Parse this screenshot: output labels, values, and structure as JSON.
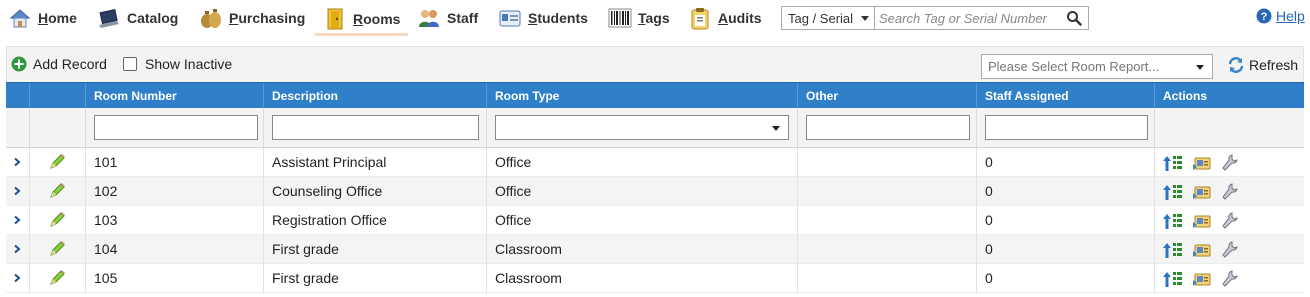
{
  "nav": {
    "items": [
      {
        "id": "home",
        "label_first": "H",
        "label_rest": "ome",
        "icon": "home-icon"
      },
      {
        "id": "catalog",
        "label_first": "",
        "label_rest": "Catalog",
        "icon": "laptop-icon"
      },
      {
        "id": "purchasing",
        "label_first": "P",
        "label_rest": "urchasing",
        "icon": "money-bags-icon"
      },
      {
        "id": "rooms",
        "label_first": "R",
        "label_rest": "ooms",
        "icon": "door-icon",
        "active": true
      },
      {
        "id": "staff",
        "label_first": "",
        "label_rest": "Staff",
        "icon": "people-icon"
      },
      {
        "id": "students",
        "label_first": "S",
        "label_rest": "tudents",
        "icon": "id-card-icon"
      },
      {
        "id": "tags",
        "label_first": "T",
        "label_rest": "ags",
        "icon": "barcode-icon"
      },
      {
        "id": "audits",
        "label_first": "A",
        "label_rest": "udits",
        "icon": "clipboard-icon"
      }
    ],
    "search": {
      "field_select": "Tag / Serial",
      "placeholder": "Search Tag or Serial Number"
    },
    "help_label": "Help"
  },
  "toolbar": {
    "add_record": "Add Record",
    "show_inactive": "Show Inactive",
    "report_placeholder": "Please Select Room Report...",
    "refresh": "Refresh"
  },
  "grid": {
    "columns": [
      "Room Number",
      "Description",
      "Room Type",
      "Other",
      "Staff Assigned",
      "Actions"
    ],
    "rows": [
      {
        "room": "101",
        "description": "Assistant Principal",
        "type": "Office",
        "other": "",
        "staff": "0"
      },
      {
        "room": "102",
        "description": "Counseling Office",
        "type": "Office",
        "other": "",
        "staff": "0"
      },
      {
        "room": "103",
        "description": "Registration Office",
        "type": "Office",
        "other": "",
        "staff": "0"
      },
      {
        "room": "104",
        "description": "First grade",
        "type": "Classroom",
        "other": "",
        "staff": "0"
      },
      {
        "room": "105",
        "description": "First grade",
        "type": "Classroom",
        "other": "",
        "staff": "0"
      }
    ]
  },
  "colors": {
    "header_blue": "#2f80c9",
    "help_blue": "#2a66b0",
    "active_underline": "#f6dcc4"
  }
}
